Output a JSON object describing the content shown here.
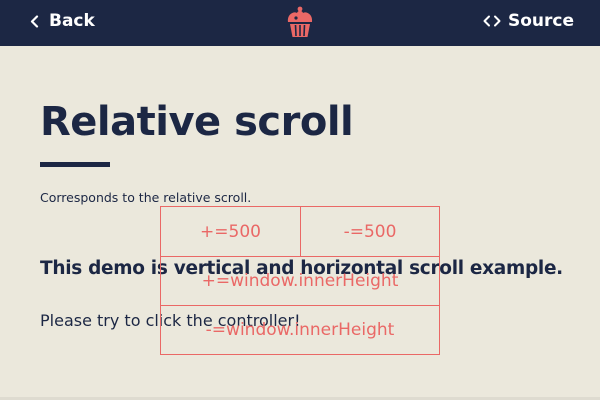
{
  "nav": {
    "back_label": "Back",
    "source_label": "Source"
  },
  "icons": {
    "back": "chevron-left-icon",
    "source": "code-brackets-icon",
    "logo": "cupcake-icon"
  },
  "colors": {
    "navbar_bg": "#1c2744",
    "page_bg": "#ebe8dc",
    "text": "#1c2744",
    "accent": "#ea6866"
  },
  "page": {
    "title": "Relative scroll",
    "description": "Corresponds to the relative scroll.",
    "heading": "This demo is vertical and horizontal scroll example.",
    "instruction": "Please try to click the controller!"
  },
  "controller": {
    "buttons": [
      {
        "label": "+=500"
      },
      {
        "label": "-=500"
      },
      {
        "label": "+=window.innerHeight"
      },
      {
        "label": "-=window.innerHeight"
      }
    ]
  }
}
